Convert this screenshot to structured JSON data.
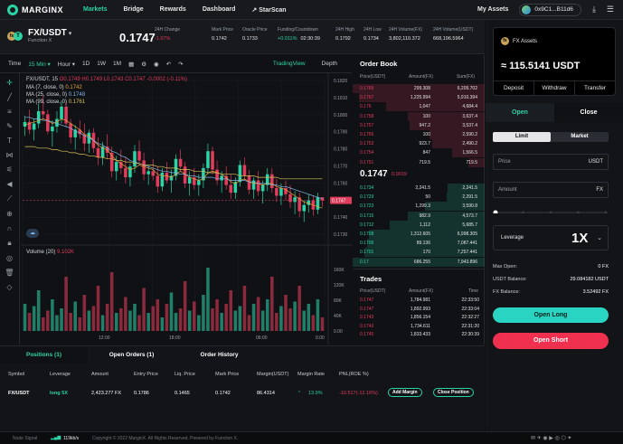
{
  "nav": {
    "brand": "MARGINX",
    "links": [
      "Markets",
      "Bridge",
      "Rewards",
      "Dashboard",
      "StarScan"
    ],
    "my_assets": "My Assets",
    "wallet": "0x9C1...B11d6"
  },
  "ticker": {
    "pair": "FX/USDT",
    "subtitle": "Function X",
    "price": "0.1747",
    "stats": [
      {
        "label": "24H Change",
        "value": "-1.07%",
        "color": "#e23c5c"
      },
      {
        "label": "Mark Price",
        "value": "0.1742",
        "color": "#e6e6e6"
      },
      {
        "label": "Oracle Price",
        "value": "0.1733",
        "color": "#e6e6e6"
      },
      {
        "label": "Funding/Countdown",
        "value": "+0.011%",
        "value2": "02:30:39",
        "color": "#2ad4a6"
      },
      {
        "label": "24H High",
        "value": "0.1792",
        "color": "#e6e6e6"
      },
      {
        "label": "24H Low",
        "value": "0.1734",
        "color": "#e6e6e6"
      },
      {
        "label": "24H Volume(FX)",
        "value": "3,802,110.372",
        "color": "#e6e6e6"
      },
      {
        "label": "24H Volume(USDT)",
        "value": "668,196.5964",
        "color": "#e6e6e6"
      }
    ]
  },
  "toolbar": {
    "time": "Time",
    "intervals": [
      "15 Min",
      "Hour",
      "1D",
      "1W",
      "1M"
    ],
    "tradingview": "TradingView",
    "depth": "Depth"
  },
  "chart_legend": {
    "title": "FX/USDT, 15",
    "ohlc": "O0.1749  H0.1749  L0.1743  C0.1747  -0.0002 (-0.11%)",
    "ma7": "MA (7, close, 0)",
    "ma7_val": "0.1742",
    "ma25": "MA (25, close, 0)",
    "ma25_val": "0.1748",
    "ma99": "MA (99, close, 0)",
    "ma99_val": "0.1761",
    "volume": "Volume (20)",
    "volume_val": "9.102K",
    "price_tag": "0.1747"
  },
  "chart_axes": {
    "price_ticks": [
      "0.1820",
      "0.1810",
      "0.1800",
      "0.1790",
      "0.1780",
      "0.1770",
      "0.1760",
      "0.1750",
      "0.1740",
      "0.1730"
    ],
    "vol_ticks": [
      "160K",
      "120K",
      "80K",
      "40K",
      "0.00"
    ],
    "time_ticks": [
      "12:00",
      "18:00",
      "06:00"
    ],
    "extra_label": "0.00"
  },
  "chart_data": {
    "type": "candlestick",
    "ylim": [
      0.1725,
      0.1825
    ],
    "candles": [
      [
        0.1795,
        0.1802,
        0.1789,
        0.1798
      ],
      [
        0.1798,
        0.1806,
        0.179,
        0.1793
      ],
      [
        0.1793,
        0.18,
        0.1786,
        0.1797
      ],
      [
        0.1797,
        0.181,
        0.1794,
        0.1805
      ],
      [
        0.1805,
        0.1815,
        0.18,
        0.1803
      ],
      [
        0.1803,
        0.1806,
        0.179,
        0.1792
      ],
      [
        0.1792,
        0.1799,
        0.1782,
        0.1795
      ],
      [
        0.1795,
        0.1805,
        0.1791,
        0.18
      ],
      [
        0.18,
        0.1812,
        0.1797,
        0.1808
      ],
      [
        0.1808,
        0.1811,
        0.1795,
        0.1797
      ],
      [
        0.1797,
        0.18,
        0.1784,
        0.1788
      ],
      [
        0.1788,
        0.1796,
        0.178,
        0.1793
      ],
      [
        0.1793,
        0.1799,
        0.1787,
        0.179
      ],
      [
        0.179,
        0.1797,
        0.1779,
        0.1784
      ],
      [
        0.1784,
        0.1793,
        0.1778,
        0.1791
      ],
      [
        0.1791,
        0.1794,
        0.1778,
        0.1781
      ],
      [
        0.1781,
        0.1788,
        0.177,
        0.1775
      ],
      [
        0.1775,
        0.1785,
        0.177,
        0.1782
      ],
      [
        0.1782,
        0.179,
        0.1774,
        0.1778
      ],
      [
        0.1778,
        0.1782,
        0.1762,
        0.1766
      ],
      [
        0.1766,
        0.1776,
        0.176,
        0.1772
      ],
      [
        0.1772,
        0.178,
        0.1764,
        0.1768
      ],
      [
        0.1768,
        0.1775,
        0.1758,
        0.1762
      ],
      [
        0.1762,
        0.1771,
        0.1756,
        0.1769
      ],
      [
        0.1769,
        0.1783,
        0.1765,
        0.1779
      ],
      [
        0.1779,
        0.1786,
        0.177,
        0.1773
      ],
      [
        0.1773,
        0.1778,
        0.176,
        0.1764
      ],
      [
        0.1764,
        0.177,
        0.1757,
        0.1766
      ],
      [
        0.1766,
        0.1774,
        0.176,
        0.1763
      ],
      [
        0.1763,
        0.1769,
        0.1752,
        0.1756
      ],
      [
        0.1756,
        0.1768,
        0.1753,
        0.1765
      ],
      [
        0.1765,
        0.1772,
        0.1758,
        0.176
      ],
      [
        0.176,
        0.1767,
        0.1752,
        0.1763
      ],
      [
        0.1763,
        0.1777,
        0.176,
        0.1774
      ],
      [
        0.1774,
        0.178,
        0.1766,
        0.1769
      ],
      [
        0.1769,
        0.1772,
        0.1755,
        0.1758
      ],
      [
        0.1758,
        0.1766,
        0.175,
        0.1762
      ],
      [
        0.1762,
        0.1768,
        0.1754,
        0.1757
      ],
      [
        0.1757,
        0.1764,
        0.175,
        0.176
      ],
      [
        0.176,
        0.1771,
        0.1755,
        0.1768
      ],
      [
        0.1768,
        0.1784,
        0.1764,
        0.1779
      ],
      [
        0.1779,
        0.1782,
        0.1764,
        0.1767
      ],
      [
        0.1767,
        0.1773,
        0.1757,
        0.176
      ],
      [
        0.176,
        0.1766,
        0.1752,
        0.1763
      ],
      [
        0.1763,
        0.1769,
        0.1754,
        0.1757
      ],
      [
        0.1757,
        0.1764,
        0.1748,
        0.1752
      ],
      [
        0.1752,
        0.1762,
        0.1748,
        0.1759
      ],
      [
        0.1759,
        0.1773,
        0.1756,
        0.177
      ],
      [
        0.177,
        0.1775,
        0.176,
        0.1763
      ],
      [
        0.1763,
        0.1767,
        0.1751,
        0.1754
      ],
      [
        0.1754,
        0.1762,
        0.1748,
        0.176
      ],
      [
        0.176,
        0.1766,
        0.175,
        0.1753
      ],
      [
        0.1753,
        0.176,
        0.1745,
        0.1757
      ],
      [
        0.1757,
        0.1768,
        0.1753,
        0.1764
      ],
      [
        0.1764,
        0.1768,
        0.1752,
        0.1755
      ],
      [
        0.1755,
        0.1761,
        0.1746,
        0.175
      ],
      [
        0.175,
        0.1758,
        0.1744,
        0.1755
      ],
      [
        0.1755,
        0.176,
        0.1747,
        0.1751
      ],
      [
        0.1751,
        0.1757,
        0.1742,
        0.1746
      ],
      [
        0.1746,
        0.1753,
        0.1738,
        0.1749
      ],
      [
        0.1749,
        0.1752,
        0.1736,
        0.174
      ],
      [
        0.174,
        0.1747,
        0.1733,
        0.1744
      ],
      [
        0.1744,
        0.1751,
        0.1739,
        0.1747
      ],
      [
        0.1747,
        0.175,
        0.1737,
        0.1741
      ],
      [
        0.1741,
        0.1752,
        0.1738,
        0.1749
      ],
      [
        0.1749,
        0.1749,
        0.1743,
        0.1747
      ]
    ],
    "volumes": [
      60,
      40,
      55,
      90,
      30,
      45,
      70,
      35,
      50,
      120,
      40,
      65,
      30,
      80,
      45,
      55,
      100,
      35,
      60,
      130,
      40,
      50,
      75,
      45,
      60,
      35,
      95,
      40,
      55,
      70,
      30,
      60,
      85,
      40,
      50,
      110,
      45,
      65,
      35,
      80,
      140,
      50,
      70,
      40,
      60,
      90,
      45,
      55,
      100,
      35,
      60,
      75,
      45,
      70,
      120,
      40,
      55,
      80,
      50,
      65,
      100,
      45,
      60,
      35,
      70,
      30
    ],
    "ma7": [
      0.1796,
      0.1797,
      0.1798,
      0.1799,
      0.18,
      0.1799,
      0.1797,
      0.1798,
      0.18,
      0.1799,
      0.1797,
      0.1795,
      0.1793,
      0.179,
      0.1789,
      0.1786,
      0.1783,
      0.1781,
      0.178,
      0.1776,
      0.1773,
      0.1771,
      0.1769,
      0.1767,
      0.1768,
      0.177,
      0.1769,
      0.1768,
      0.1767,
      0.1764,
      0.1763,
      0.1763,
      0.1762,
      0.1764,
      0.1766,
      0.1764,
      0.1762,
      0.1761,
      0.176,
      0.1761,
      0.1765,
      0.1766,
      0.1765,
      0.1764,
      0.1762,
      0.1759,
      0.1758,
      0.176,
      0.1761,
      0.1759,
      0.1758,
      0.1758,
      0.1757,
      0.1758,
      0.1758,
      0.1756,
      0.1755,
      0.1754,
      0.1752,
      0.175,
      0.1748,
      0.1746,
      0.1745,
      0.1744,
      0.1743,
      0.1742
    ],
    "ma25": [
      0.1801,
      0.1801,
      0.18,
      0.18,
      0.1799,
      0.1799,
      0.1798,
      0.1797,
      0.1796,
      0.1795,
      0.1794,
      0.1792,
      0.1791,
      0.1789,
      0.1788,
      0.1786,
      0.1784,
      0.1783,
      0.1781,
      0.1779,
      0.1778,
      0.1776,
      0.1775,
      0.1773,
      0.1772,
      0.1771,
      0.177,
      0.1769,
      0.1768,
      0.1767,
      0.1766,
      0.1766,
      0.1765,
      0.1765,
      0.1764,
      0.1764,
      0.1763,
      0.1763,
      0.1762,
      0.1762,
      0.1762,
      0.1762,
      0.1761,
      0.1761,
      0.1761,
      0.176,
      0.176,
      0.176,
      0.176,
      0.1759,
      0.1759,
      0.1758,
      0.1758,
      0.1758,
      0.1757,
      0.1757,
      0.1756,
      0.1756,
      0.1755,
      0.1754,
      0.1753,
      0.1752,
      0.1751,
      0.175,
      0.1749,
      0.1748
    ],
    "ma99": [
      0.1782,
      0.1782,
      0.1782,
      0.1781,
      0.1781,
      0.1781,
      0.178,
      0.178,
      0.1779,
      0.1779,
      0.1778,
      0.1778,
      0.1777,
      0.1777,
      0.1776,
      0.1776,
      0.1775,
      0.1775,
      0.1774,
      0.1774,
      0.1773,
      0.1773,
      0.1772,
      0.1772,
      0.1771,
      0.1771,
      0.177,
      0.177,
      0.177,
      0.1769,
      0.1769,
      0.1768,
      0.1768,
      0.1768,
      0.1767,
      0.1767,
      0.1767,
      0.1766,
      0.1766,
      0.1766,
      0.1765,
      0.1765,
      0.1765,
      0.1764,
      0.1764,
      0.1764,
      0.1764,
      0.1763,
      0.1763,
      0.1763,
      0.1763,
      0.1762,
      0.1762,
      0.1762,
      0.1762,
      0.1762,
      0.1761,
      0.1761,
      0.1761,
      0.1761,
      0.1761,
      0.1761,
      0.1761,
      0.1761,
      0.1761,
      0.1761
    ]
  },
  "orderbook": {
    "title": "Order Book",
    "headers": [
      "Price(USDT)",
      "Amount(FX)",
      "Sum(FX)"
    ],
    "asks": [
      [
        "0.1769",
        "299.308",
        "6,209.702"
      ],
      [
        "0.1767",
        "1,225.994",
        "5,910.394"
      ],
      [
        "0.176",
        "1,047",
        "4,684.4"
      ],
      [
        "0.1758",
        "100",
        "3,637.4"
      ],
      [
        "0.1757",
        "947.2",
        "3,537.4"
      ],
      [
        "0.1756",
        "100",
        "2,590.2"
      ],
      [
        "0.1753",
        "923.7",
        "2,490.2"
      ],
      [
        "0.1754",
        "847",
        "1,566.5"
      ],
      [
        "0.1751",
        "719.5",
        "719.5"
      ]
    ],
    "ask_depth": [
      1.0,
      0.95,
      0.75,
      0.58,
      0.57,
      0.42,
      0.4,
      0.25,
      0.12
    ],
    "mid_price": "0.1747",
    "mid_sub": "0.0019",
    "bids": [
      [
        "0.1734",
        "2,241.5",
        "2,241.5"
      ],
      [
        "0.1729",
        "50",
        "2,291.5"
      ],
      [
        "0.1723",
        "1,299.3",
        "3,590.8"
      ],
      [
        "0.1715",
        "982.9",
        "4,573.7"
      ],
      [
        "0.1712",
        "1,112",
        "5,685.7"
      ],
      [
        "0.1708",
        "1,312.605",
        "6,998.305"
      ],
      [
        "0.1706",
        "89.136",
        "7,087.441"
      ],
      [
        "0.1701",
        "170",
        "7,257.441"
      ],
      [
        "0.17",
        "686.255",
        "7,943.896"
      ]
    ],
    "bid_depth": [
      0.28,
      0.29,
      0.45,
      0.58,
      0.72,
      0.88,
      0.89,
      0.91,
      1.0
    ]
  },
  "trades": {
    "title": "Trades",
    "headers": [
      "Price(USDT)",
      "Amount(FX)",
      "Time"
    ],
    "rows": [
      [
        "0.1747",
        "1,784.981",
        "22:33:50"
      ],
      [
        "0.1747",
        "1,892.993",
        "22:33:04"
      ],
      [
        "0.1743",
        "1,856.154",
        "22:32:27"
      ],
      [
        "0.1743",
        "1,734.611",
        "22:31:20"
      ],
      [
        "0.1745",
        "1,833.433",
        "22:30:39"
      ]
    ]
  },
  "assets": {
    "label": "FX Assets",
    "value": "≈ 115.5141 USDT",
    "actions": [
      "Deposit",
      "Withdraw",
      "Transfer"
    ]
  },
  "order": {
    "tab_open": "Open",
    "tab_close": "Close",
    "limit": "Limit",
    "market": "Market",
    "price_placeholder": "Price",
    "price_unit": "USDT",
    "amount_placeholder": "Amount",
    "amount_unit": "FX",
    "slider_fraction": 0.0,
    "leverage_label": "Leverage",
    "leverage_value": "1X",
    "max_open_label": "Max Open:",
    "max_open": "0 FX",
    "usdt_balance_label": "USDT Balance:",
    "usdt_balance": "29.084182 USDT",
    "fx_balance_label": "FX Balance:",
    "fx_balance": "3.52492 FX",
    "open_long": "Open Long",
    "open_short": "Open Short"
  },
  "positions": {
    "tabs": [
      "Positions (1)",
      "Open Orders (1)",
      "Order History"
    ],
    "headers": [
      "Symbol",
      "Leverage",
      "Amount",
      "Entry Price",
      "Liq. Price",
      "Mark Price",
      "Margin(USDT)",
      "Margin Rate",
      "PNL(ROE %)"
    ],
    "row": {
      "symbol": "FX/USDT",
      "leverage": "long 5X",
      "amount": "2,423.277 FX",
      "entry": "0.1786",
      "liq": "0.1465",
      "mark": "0.1742",
      "margin": "86.4314",
      "margin_rate": "13.9%",
      "pnl": "-10.517(-12.16%)",
      "add_margin": "Add Margin",
      "close_position": "Close Position"
    }
  },
  "footer": {
    "node_signal": "Node Signal",
    "speed": "119kb/s",
    "copyright": "Copyright © 2022 MarginX. All Rights Reserved. Powered by Function X."
  },
  "colors": {
    "accent": "#2ad4a6",
    "down": "#e23c5c",
    "up": "#2ad4a6",
    "short": "#f0304f",
    "long": "#2ad4c2"
  }
}
